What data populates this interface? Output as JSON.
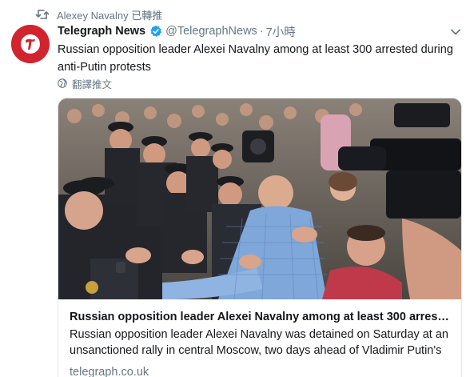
{
  "retweet": {
    "text": "Alexey Navalny 已轉推"
  },
  "tweet": {
    "display_name": "Telegraph News",
    "handle": "@TelegraphNews",
    "separator": "·",
    "time": "7小時",
    "text": "Russian opposition leader Alexei Navalny among at least 300 arrested during anti-Putin protests",
    "translate_label": "翻譯推文"
  },
  "card": {
    "title": "Russian opposition leader Alexei Navalny among at least 300 arreste...",
    "description": "Russian opposition leader Alexei Navalny was detained on Saturday at an unsanctioned rally in central Moscow, two days ahead of Vladimir Putin's",
    "domain": "telegraph.co.uk"
  },
  "icons": {
    "retweet": "retweet-icon",
    "verified": "verified-badge-icon",
    "menu": "chevron-down-icon",
    "globe": "globe-icon",
    "avatar_logo": "telegraph-t-logo"
  },
  "colors": {
    "brand_red": "#d1242f",
    "verified_blue": "#1da1f2",
    "muted_text": "#657786",
    "border": "#e1e8ed"
  }
}
